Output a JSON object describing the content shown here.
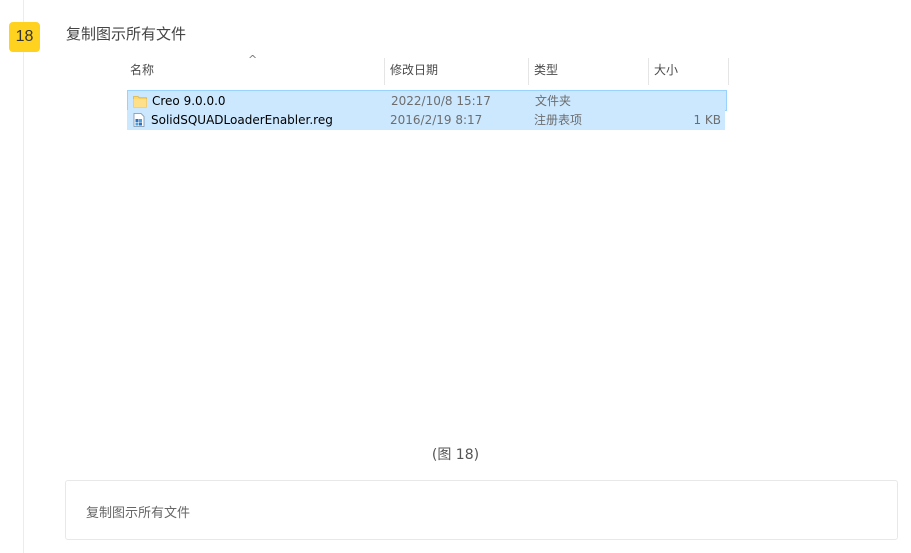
{
  "step": {
    "number": "18",
    "title": "复制图示所有文件"
  },
  "explorer": {
    "columns": {
      "name": "名称",
      "date": "修改日期",
      "type": "类型",
      "size": "大小"
    },
    "sort_indicator": "^",
    "files": [
      {
        "name": "Creo 9.0.0.0",
        "date": "2022/10/8 15:17",
        "type": "文件夹",
        "size": "",
        "icon": "folder-icon"
      },
      {
        "name": "SolidSQUADLoaderEnabler.reg",
        "date": "2016/2/19 8:17",
        "type": "注册表项",
        "size": "1 KB",
        "icon": "registry-file-icon"
      }
    ]
  },
  "caption": "(图 18)",
  "note": "复制图示所有文件",
  "colors": {
    "badge": "#ffd21f",
    "selection": "#cce8ff",
    "selection_border": "#99d1ff"
  }
}
